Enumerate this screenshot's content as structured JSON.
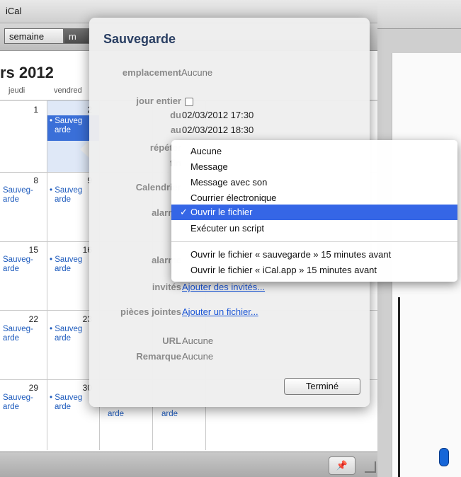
{
  "app": {
    "title": "iCal"
  },
  "toolbar": {
    "week_label": "semaine",
    "month_label": "m"
  },
  "calendar": {
    "month_title": "rs 2012",
    "day_names": [
      "jeudi",
      "vendred"
    ],
    "weeks": [
      {
        "thu": "1",
        "fri": "2"
      },
      {
        "thu": "8",
        "fri": "9"
      },
      {
        "thu": "15",
        "fri": "16"
      },
      {
        "thu": "22",
        "fri": "23"
      },
      {
        "thu": "29",
        "fri": "30"
      }
    ],
    "left_event": [
      "Sauveg-",
      "arde"
    ],
    "event_line1": "Sauveg",
    "event_line2": "arde",
    "bottom_events": [
      "arde",
      "arde"
    ]
  },
  "popover": {
    "title": "Sauvegarde",
    "labels": {
      "location": "emplacement",
      "allday": "jour entier",
      "from": "du",
      "to": "au",
      "repeat": "répéter",
      "end": "fin",
      "calendar": "Calendrier",
      "alarm1": "alarme",
      "alarm2": "alarme",
      "invitees": "invités",
      "attachments": "pièces jointes",
      "url": "URL",
      "note": "Remarque"
    },
    "values": {
      "location": "Aucune",
      "from": "02/03/2012 17:30",
      "to": "02/03/2012 18:30",
      "invitees": "Ajouter des invités...",
      "attachments": "Ajouter un fichier...",
      "url": "Aucune",
      "note": "Aucune"
    },
    "done_label": "Terminé"
  },
  "alarm_menu": {
    "items": [
      "Aucune",
      "Message",
      "Message avec son",
      "Courrier électronique",
      "Ouvrir le fichier",
      "Exécuter un script",
      "Ouvrir le fichier « sauvegarde » 15 minutes avant",
      "Ouvrir le fichier « iCal.app » 15 minutes avant"
    ],
    "selected_index": 4,
    "check_mark": "✓"
  },
  "colors": {
    "accent": "#3566e6",
    "link": "#1a55d6",
    "event": "#1e5bbd"
  }
}
